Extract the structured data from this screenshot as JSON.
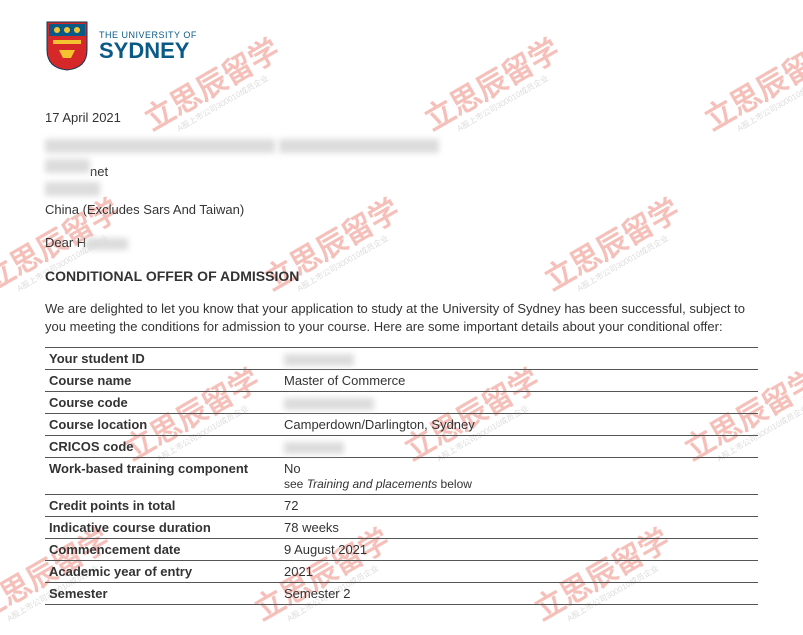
{
  "watermark": {
    "main": "立思辰留学",
    "sub": "A股上市公司300010成员企业"
  },
  "university": {
    "top": "THE UNIVERSITY OF",
    "name": "SYDNEY"
  },
  "date": "17 April 2021",
  "address": {
    "net_suffix": "net",
    "country": "China (Excludes Sars And Taiwan)"
  },
  "salutation_prefix": "Dear H",
  "title": "CONDITIONAL OFFER OF ADMISSION",
  "paragraph": "We are delighted to let you know that your application to study at the University of Sydney has been successful, subject to you meeting the conditions for admission to your course. Here are some important details about your conditional offer:",
  "table": {
    "student_id": {
      "label": "Your student ID",
      "value": ""
    },
    "course_name": {
      "label": "Course name",
      "value": "Master of Commerce"
    },
    "course_code": {
      "label": "Course code",
      "value": ""
    },
    "course_location": {
      "label": "Course location",
      "value": "Camperdown/Darlington, Sydney"
    },
    "cricos_code": {
      "label": "CRICOS code",
      "value": ""
    },
    "work_based": {
      "label": "Work-based training component",
      "value": "No",
      "note_prefix": "see ",
      "note_em": "Training and placements",
      "note_suffix": " below"
    },
    "credit_points": {
      "label": "Credit points in total",
      "value": "72"
    },
    "duration": {
      "label": "Indicative course duration",
      "value": "78 weeks"
    },
    "commencement": {
      "label": "Commencement date",
      "value": "9 August 2021"
    },
    "academic_year": {
      "label": "Academic year of entry",
      "value": "2021"
    },
    "semester": {
      "label": "Semester",
      "value": "Semester 2"
    }
  }
}
